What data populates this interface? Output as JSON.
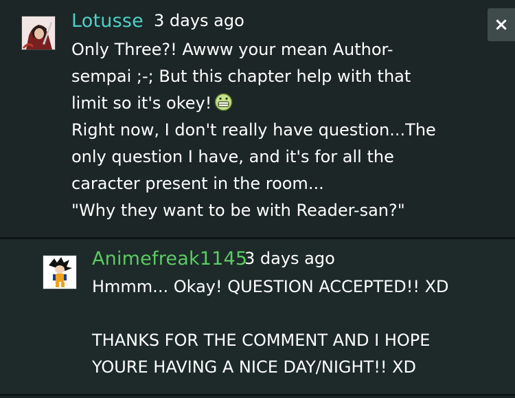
{
  "comments": [
    {
      "username": "Lotusse",
      "time": "3 days ago",
      "lines": [
        "Only Three?! Awww your mean Author-",
        "sempai ;-; But this chapter help with that",
        "limit so it's okey!",
        "Right now, I don't really have question...The",
        "only question I have, and it's for all the",
        "caracter present in the room...",
        "\"Why they want to be with Reader-san?\""
      ],
      "emoji": "grinning-face-emoji",
      "username_color": "#4fd0c8"
    },
    {
      "username": "Animefreak1145",
      "time": "3 days ago",
      "lines": [
        "Hmmm... Okay! QUESTION ACCEPTED!! XD",
        "",
        "THANKS FOR THE COMMENT AND I HOPE",
        "YOURE HAVING A NICE DAY/NIGHT!! XD"
      ],
      "username_color": "#5ccb63"
    }
  ],
  "close_button": {
    "label": "×",
    "icon": "close-icon"
  }
}
